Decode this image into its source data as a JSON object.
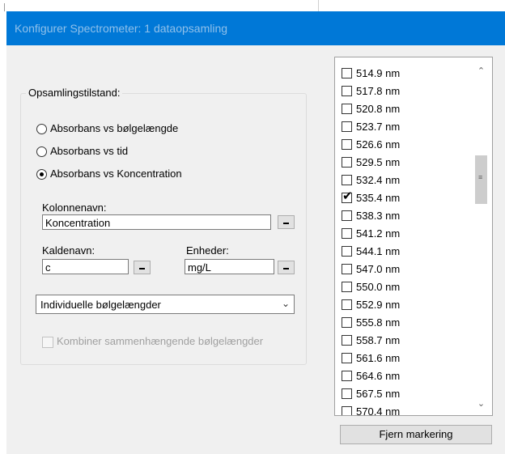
{
  "window": {
    "title": "Konfigurer Spectrometer: 1 dataopsamling"
  },
  "mode_group": {
    "legend": "Opsamlingstilstand:",
    "options": [
      {
        "label": "Absorbans vs bølgelængde",
        "selected": false
      },
      {
        "label": "Absorbans vs tid",
        "selected": false
      },
      {
        "label": "Absorbans vs Koncentration",
        "selected": true
      }
    ]
  },
  "column": {
    "label": "Kolonnenavn:",
    "value": "Koncentration"
  },
  "short_name": {
    "label": "Kaldenavn:",
    "value": "c"
  },
  "units": {
    "label": "Enheder:",
    "value": "mg/L"
  },
  "wavelength_mode": {
    "selected": "Individuelle bølgelængder"
  },
  "combine": {
    "label": "Kombiner sammenhængende bølgelængder",
    "checked": false,
    "enabled": false
  },
  "wavelengths": {
    "items": [
      {
        "label": "514.9 nm",
        "checked": false
      },
      {
        "label": "517.8 nm",
        "checked": false
      },
      {
        "label": "520.8 nm",
        "checked": false
      },
      {
        "label": "523.7 nm",
        "checked": false
      },
      {
        "label": "526.6 nm",
        "checked": false
      },
      {
        "label": "529.5 nm",
        "checked": false
      },
      {
        "label": "532.4 nm",
        "checked": false
      },
      {
        "label": "535.4 nm",
        "checked": true
      },
      {
        "label": "538.3 nm",
        "checked": false
      },
      {
        "label": "541.2 nm",
        "checked": false
      },
      {
        "label": "544.1 nm",
        "checked": false
      },
      {
        "label": "547.0 nm",
        "checked": false
      },
      {
        "label": "550.0 nm",
        "checked": false
      },
      {
        "label": "552.9 nm",
        "checked": false
      },
      {
        "label": "555.8 nm",
        "checked": false
      },
      {
        "label": "558.7 nm",
        "checked": false
      },
      {
        "label": "561.6 nm",
        "checked": false
      },
      {
        "label": "564.6 nm",
        "checked": false
      },
      {
        "label": "567.5 nm",
        "checked": false
      },
      {
        "label": "570.4 nm",
        "checked": false
      }
    ],
    "clear_label": "Fjern markering"
  },
  "colors": {
    "titlebar": "#0078d7",
    "dialog_bg": "#f0f0f0"
  }
}
